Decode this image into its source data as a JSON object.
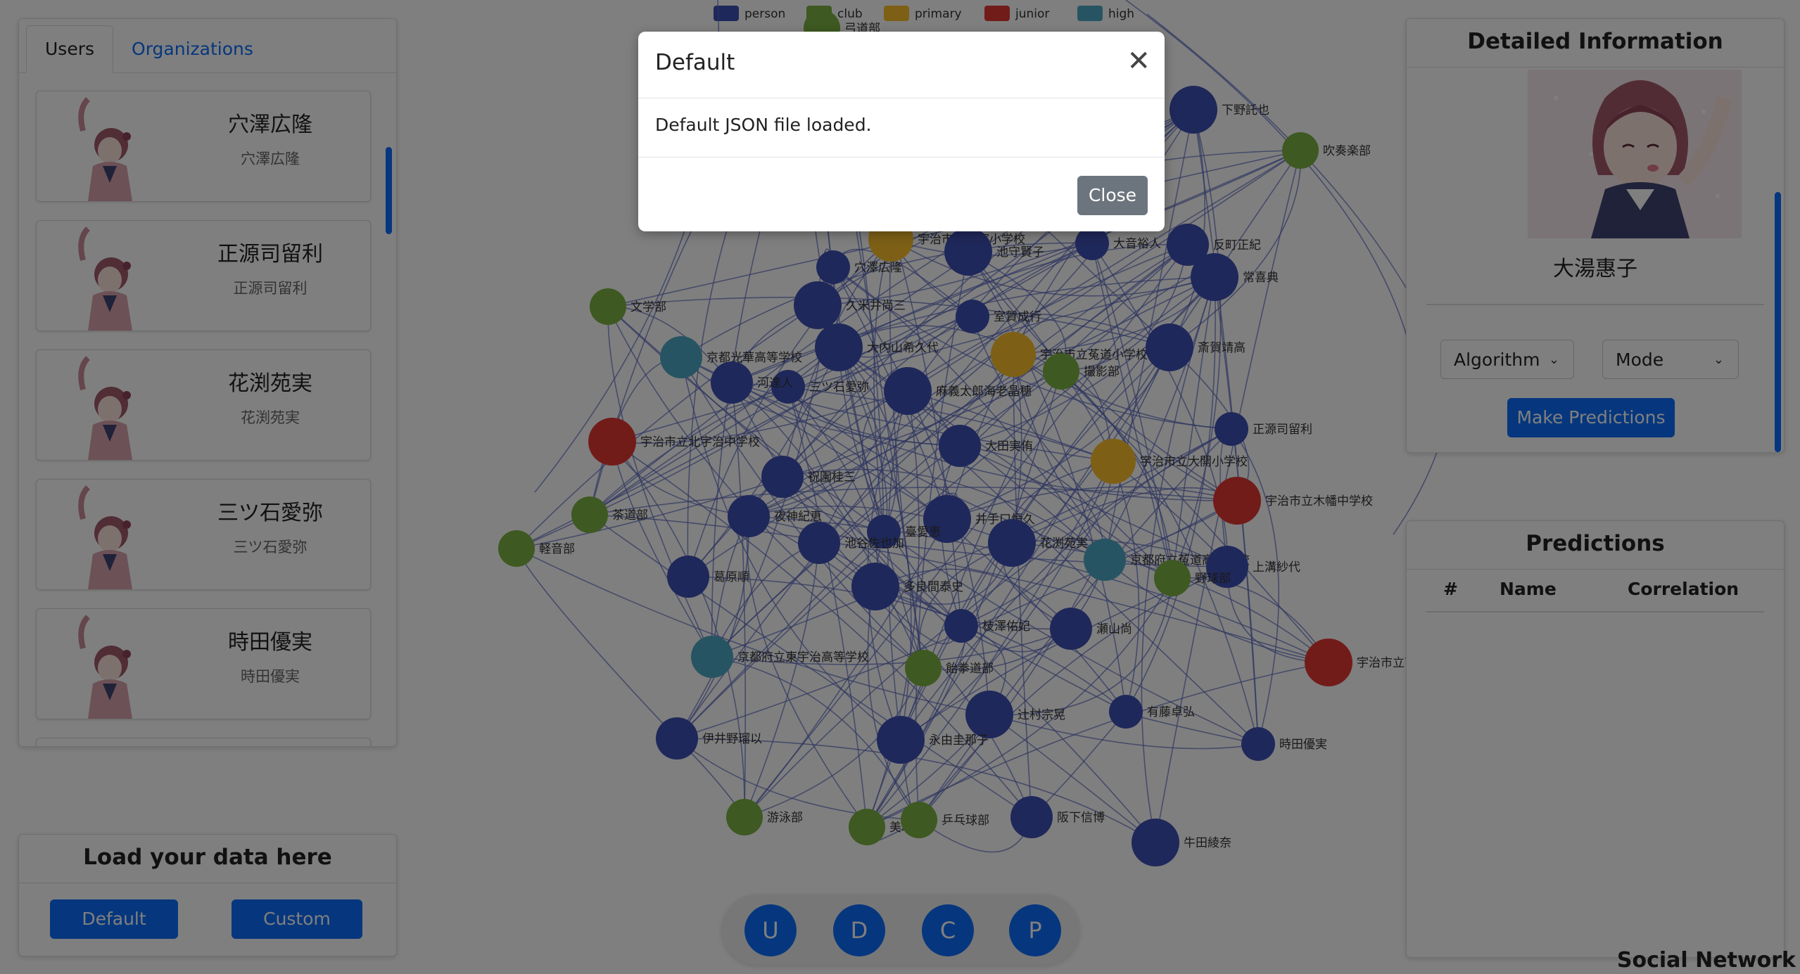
{
  "tabs": {
    "users": "Users",
    "organizations": "Organizations"
  },
  "users": [
    {
      "name": "穴澤広隆",
      "sub": "穴澤広隆"
    },
    {
      "name": "正源司留利",
      "sub": "正源司留利"
    },
    {
      "name": "花渕苑実",
      "sub": "花渕苑実"
    },
    {
      "name": "三ツ石愛弥",
      "sub": "三ツ石愛弥"
    },
    {
      "name": "時田優実",
      "sub": "時田優実"
    }
  ],
  "load": {
    "title": "Load your data here",
    "default_label": "Default",
    "custom_label": "Custom"
  },
  "detail": {
    "title": "Detailed Information",
    "name": "大湯惠子",
    "algorithm_label": "Algorithm",
    "mode_label": "Mode",
    "predict_label": "Make Predictions"
  },
  "predictions": {
    "title": "Predictions",
    "col_num": "#",
    "col_name": "Name",
    "col_corr": "Correlation"
  },
  "legend": [
    {
      "label": "person",
      "color": "#3f51b5"
    },
    {
      "label": "club",
      "color": "#7cb342"
    },
    {
      "label": "primary",
      "color": "#fbc02d"
    },
    {
      "label": "junior",
      "color": "#e53935"
    },
    {
      "label": "high",
      "color": "#4fa9c4"
    }
  ],
  "fab": {
    "u": "U",
    "d": "D",
    "c": "C",
    "p": "P"
  },
  "watermark": "Social Network",
  "modal": {
    "title": "Default",
    "body": "Default JSON file loaded.",
    "close_label": "Close"
  },
  "colors": {
    "accent": "#0d6efd",
    "secondary": "#6c757d",
    "edge": "#5c6bc0"
  },
  "nodes": [
    {
      "label": "下野託也",
      "type": "person"
    },
    {
      "label": "吹奏楽部",
      "type": "club"
    },
    {
      "label": "宇治市立三室小学校",
      "type": "primary"
    },
    {
      "label": "池守賢子",
      "type": "person"
    },
    {
      "label": "大音裕人",
      "type": "person"
    },
    {
      "label": "反町正紀",
      "type": "person"
    },
    {
      "label": "常喜典",
      "type": "person"
    },
    {
      "label": "穴澤広隆",
      "type": "person"
    },
    {
      "label": "文学部",
      "type": "club"
    },
    {
      "label": "久米井尚三",
      "type": "person"
    },
    {
      "label": "室賀成行",
      "type": "person"
    },
    {
      "label": "京都光華高等学校",
      "type": "high"
    },
    {
      "label": "大内山希久代",
      "type": "person"
    },
    {
      "label": "宇治市立菟道小学校",
      "type": "primary"
    },
    {
      "label": "撮影部",
      "type": "club"
    },
    {
      "label": "斎賀靖高",
      "type": "person"
    },
    {
      "label": "三ツ石愛弥",
      "type": "person"
    },
    {
      "label": "河達人",
      "type": "person"
    },
    {
      "label": "麻義太郎海老晶穂",
      "type": "person"
    },
    {
      "label": "宇治市立北宇治中学校",
      "type": "junior"
    },
    {
      "label": "大田実侑",
      "type": "person"
    },
    {
      "label": "宇治市立大開小学校",
      "type": "primary"
    },
    {
      "label": "正源司留利",
      "type": "person"
    },
    {
      "label": "祝園桂三",
      "type": "person"
    },
    {
      "label": "宇治市立木幡中学校",
      "type": "junior"
    },
    {
      "label": "茶道部",
      "type": "club"
    },
    {
      "label": "夜神紀恵",
      "type": "person"
    },
    {
      "label": "井手口恒久",
      "type": "person"
    },
    {
      "label": "臺愛恵",
      "type": "person"
    },
    {
      "label": "池谷佐也加",
      "type": "person"
    },
    {
      "label": "花渕苑実",
      "type": "person"
    },
    {
      "label": "京都府立菟道高等学校",
      "type": "high"
    },
    {
      "label": "上溝紗代",
      "type": "person"
    },
    {
      "label": "野球部",
      "type": "club"
    },
    {
      "label": "軽音部",
      "type": "club"
    },
    {
      "label": "葛原順",
      "type": "person"
    },
    {
      "label": "多良間泰史",
      "type": "person"
    },
    {
      "label": "枝澤佑妃",
      "type": "person"
    },
    {
      "label": "瀬山尚",
      "type": "person"
    },
    {
      "label": "京都府立東宇治高等学校",
      "type": "high"
    },
    {
      "label": "飴拳道部",
      "type": "club"
    },
    {
      "label": "宇治市立南宇治中学校",
      "type": "junior"
    },
    {
      "label": "辻村宗晃",
      "type": "person"
    },
    {
      "label": "有藤卓弘",
      "type": "person"
    },
    {
      "label": "伊井野瑠以",
      "type": "person"
    },
    {
      "label": "永由圭那子",
      "type": "person"
    },
    {
      "label": "時田優実",
      "type": "person"
    },
    {
      "label": "游泳部",
      "type": "club"
    },
    {
      "label": "美术部",
      "type": "club"
    },
    {
      "label": "乒乓球部",
      "type": "club"
    },
    {
      "label": "阪下信博",
      "type": "person"
    },
    {
      "label": "牛田綾奈",
      "type": "person"
    },
    {
      "label": "弓道部",
      "type": "club"
    }
  ]
}
